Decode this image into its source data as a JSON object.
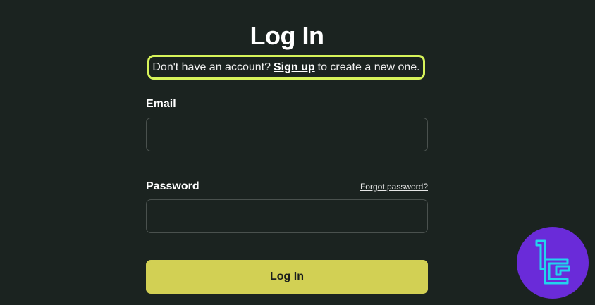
{
  "page": {
    "title": "Log In"
  },
  "signup_note": {
    "prefix": "Don't have an account?",
    "link": "Sign up",
    "suffix": "to create a new one."
  },
  "email": {
    "label": "Email",
    "value": "",
    "placeholder": ""
  },
  "password": {
    "label": "Password",
    "value": "",
    "placeholder": "",
    "forgot_link": "Forgot password?"
  },
  "submit": {
    "label": "Log In"
  },
  "colors": {
    "background": "#1b2320",
    "highlight_border": "#d7f35a",
    "button": "#d2d054",
    "badge": "#6a2bd9",
    "badge_logo": "#22d3ee"
  },
  "icons": {
    "badge_logo": "tc-logo-icon"
  }
}
